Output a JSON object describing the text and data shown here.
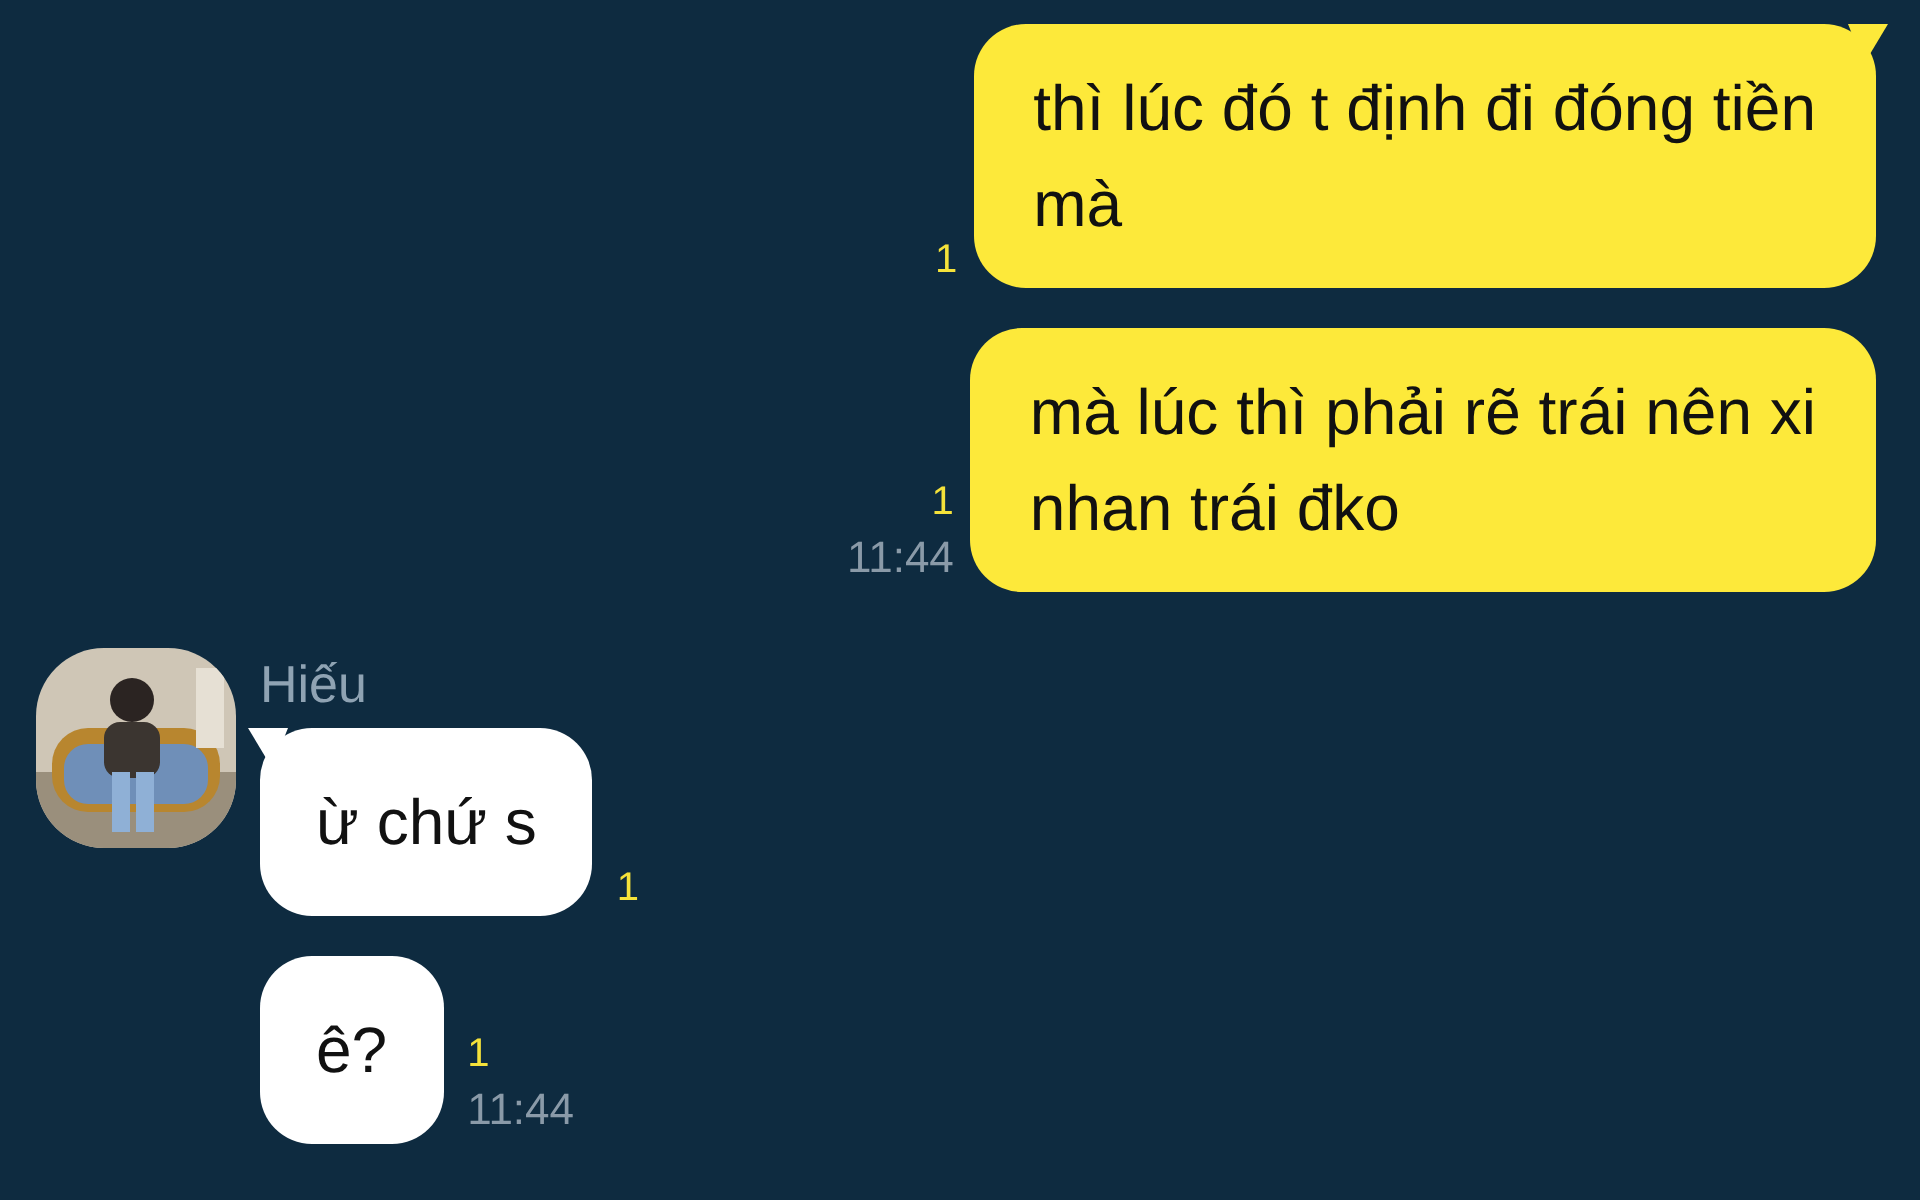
{
  "messages": [
    {
      "kind": "outgoing",
      "text": "thì lúc đó  t định đi đóng tiền\nmà",
      "unread": "1",
      "tail": true
    },
    {
      "kind": "outgoing",
      "text": "mà lúc thì phải rẽ trái nên xi\nnhan trái đko",
      "unread": "1",
      "time": "11:44",
      "tail": false
    },
    {
      "kind": "incoming",
      "sender": "Hiếu",
      "text": "ừ chứ s",
      "unread": "1",
      "tail": true
    },
    {
      "kind": "incoming",
      "text": "ê?",
      "unread": "1",
      "time": "11:44",
      "tail": false
    }
  ]
}
